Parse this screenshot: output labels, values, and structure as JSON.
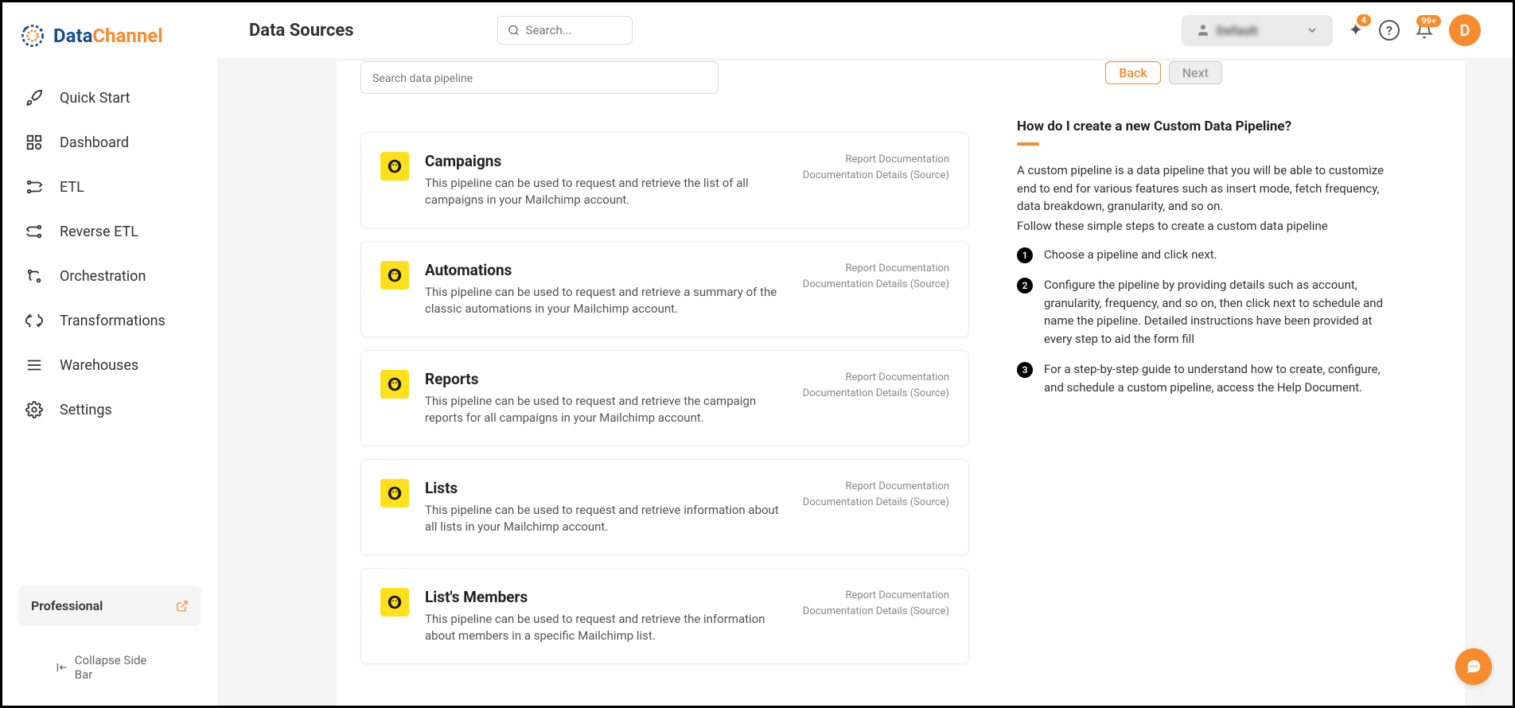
{
  "logo": {
    "data": "Data",
    "channel": "Channel"
  },
  "sidebar": {
    "items": [
      {
        "label": "Quick Start"
      },
      {
        "label": "Dashboard"
      },
      {
        "label": "ETL"
      },
      {
        "label": "Reverse ETL"
      },
      {
        "label": "Orchestration"
      },
      {
        "label": "Transformations"
      },
      {
        "label": "Warehouses"
      },
      {
        "label": "Settings"
      }
    ],
    "plan": "Professional",
    "collapse": "Collapse Side Bar"
  },
  "header": {
    "title": "Data Sources",
    "search_placeholder": "Search...",
    "user_name": "Default",
    "notif_count": "4",
    "bell_count": "99+",
    "avatar": "D"
  },
  "content": {
    "search_placeholder": "Search data pipeline",
    "back_btn": "Back",
    "next_btn": "Next",
    "pipelines": [
      {
        "title": "Campaigns",
        "desc": "This pipeline can be used to request and retrieve the list of all campaigns in your Mailchimp account.",
        "link1": "Report Documentation",
        "link2": "Documentation Details (Source)"
      },
      {
        "title": "Automations",
        "desc": "This pipeline can be used to request and retrieve a summary of the classic automations in your Mailchimp account.",
        "link1": "Report Documentation",
        "link2": "Documentation Details (Source)"
      },
      {
        "title": "Reports",
        "desc": "This pipeline can be used to request and retrieve the campaign reports for all campaigns in your Mailchimp account.",
        "link1": "Report Documentation",
        "link2": "Documentation Details (Source)"
      },
      {
        "title": "Lists",
        "desc": "This pipeline can be used to request and retrieve information about all lists in your Mailchimp account.",
        "link1": "Report Documentation",
        "link2": "Documentation Details (Source)"
      },
      {
        "title": "List's Members",
        "desc": "This pipeline can be used to request and retrieve the information about members in a specific Mailchimp list.",
        "link1": "Report Documentation",
        "link2": "Documentation Details (Source)"
      }
    ]
  },
  "help": {
    "title": "How do I create a new Custom Data Pipeline?",
    "intro": "A custom pipeline is a data pipeline that you will be able to customize end to end for various features such as insert mode, fetch frequency, data breakdown, granularity, and so on.",
    "sub": "Follow these simple steps to create a custom data pipeline",
    "steps": [
      "Choose a pipeline and click next.",
      "Configure the pipeline by providing details such as account, granularity, frequency, and so on, then click next to schedule and name the pipeline. Detailed instructions have been provided at every step to aid the form fill",
      "For a step-by-step guide to understand how to create, configure, and schedule a custom pipeline, access the Help Document."
    ]
  }
}
